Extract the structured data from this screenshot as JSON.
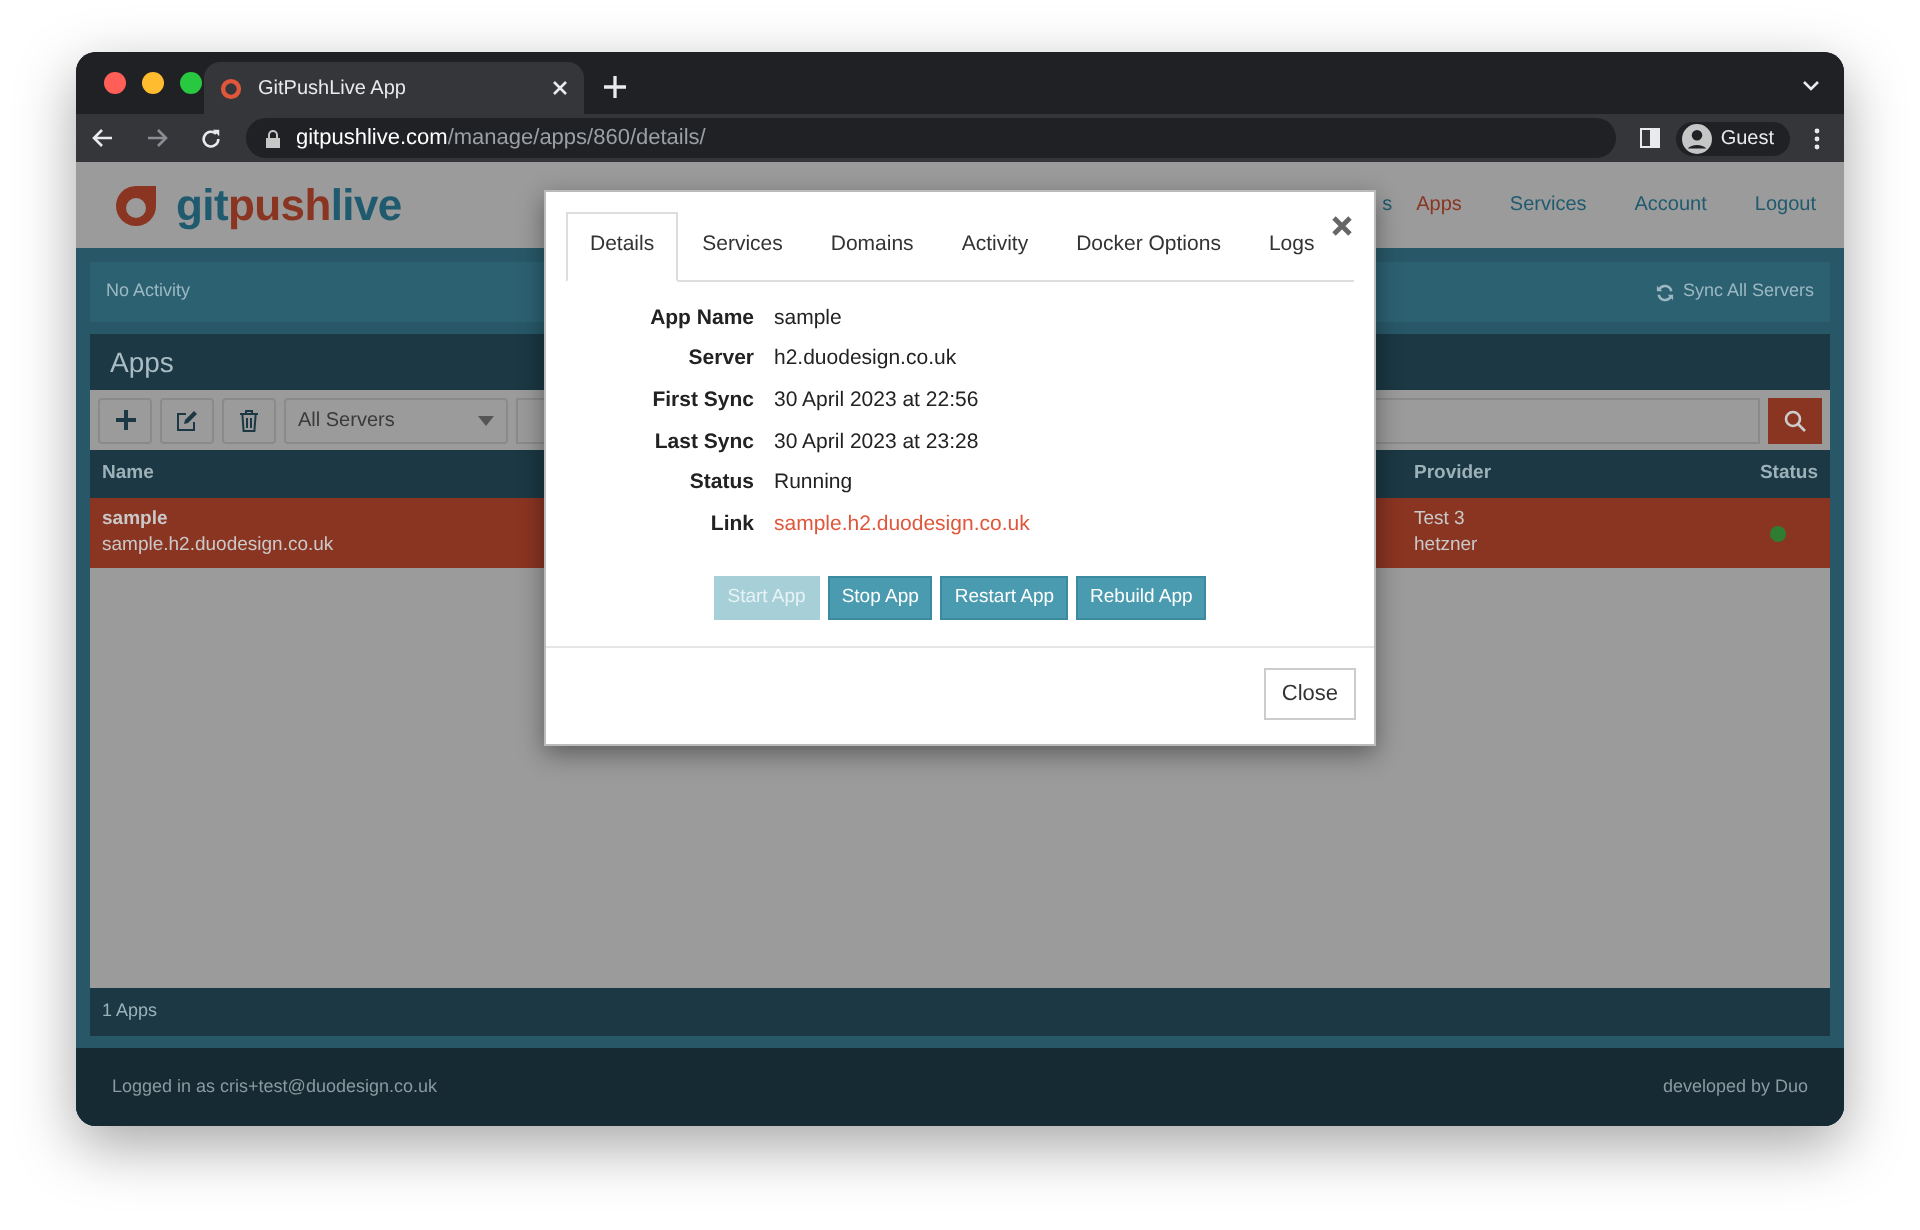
{
  "browser": {
    "tab_title": "GitPushLive App",
    "url_domain": "gitpushlive.com",
    "url_path": "/manage/apps/860/details/",
    "profile": "Guest"
  },
  "header": {
    "logo_parts": [
      {
        "text": "git",
        "accent": false
      },
      {
        "text": "push",
        "accent": true
      },
      {
        "text": "live",
        "accent": false
      }
    ],
    "nav": [
      {
        "label": "s",
        "selected": false
      },
      {
        "label": "Apps",
        "selected": true
      },
      {
        "label": "Services",
        "selected": false
      },
      {
        "label": "Account",
        "selected": false
      },
      {
        "label": "Logout",
        "selected": false
      }
    ]
  },
  "activity": {
    "text": "No Activity",
    "sync_button": "Sync All Servers"
  },
  "apps_panel": {
    "title": "Apps",
    "server_filter": "All Servers",
    "columns": [
      "Name",
      "Provider",
      "Status"
    ],
    "rows": [
      {
        "name": "sample",
        "domain": "sample.h2.duodesign.co.uk",
        "provider": "Test 3",
        "provider_type": "hetzner",
        "color": "#2e7d32",
        "selected": true
      }
    ],
    "count": "1 Apps"
  },
  "footer": {
    "logged_in": "Logged in as cris+test@duodesign.co.uk",
    "credit": "developed by Duo"
  },
  "modal": {
    "tabs": [
      {
        "label": "Details",
        "selected": true
      },
      {
        "label": "Services",
        "selected": false
      },
      {
        "label": "Domains",
        "selected": false
      },
      {
        "label": "Activity",
        "selected": false
      },
      {
        "label": "Docker Options",
        "selected": false
      },
      {
        "label": "Logs",
        "selected": false
      }
    ],
    "details": [
      {
        "label": "App Name",
        "value": "sample",
        "kind": "text"
      },
      {
        "label": "Server",
        "value": "h2.duodesign.co.uk",
        "kind": "text"
      },
      {
        "label": "First Sync",
        "value": "30 April 2023 at 22:56",
        "kind": "text"
      },
      {
        "label": "Last Sync",
        "value": "30 April 2023 at 23:28",
        "kind": "text"
      },
      {
        "label": "Status",
        "value": "Running",
        "kind": "text"
      },
      {
        "label": "Link",
        "value": "sample.h2.duodesign.co.uk",
        "kind": "link"
      }
    ],
    "actions": [
      {
        "label": "Start App",
        "disabled": true
      },
      {
        "label": "Stop App",
        "disabled": false
      },
      {
        "label": "Restart App",
        "disabled": false
      },
      {
        "label": "Rebuild App",
        "disabled": false
      }
    ],
    "close_button": "Close"
  }
}
